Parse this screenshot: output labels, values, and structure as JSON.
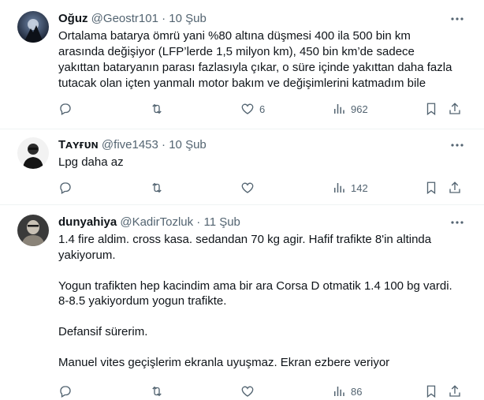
{
  "tweets": [
    {
      "name": "Oğuz",
      "handle": "@Geostr101",
      "sep": "·",
      "date": "10 Şub",
      "text": "Ortalama batarya ömrü yani %80 altına düşmesi 400 ila 500 bin km arasında değişiyor (LFP’lerde 1,5 milyon km), 450 bin km’de sadece yakıttan bataryanın parası fazlasıyla çıkar, o süre içinde yakıttan daha fazla tutacak olan içten yanmalı motor bakım ve değişimlerini katmadım bile",
      "likes": "6",
      "views": "962"
    },
    {
      "name": "Tᴀʏғᴜɴ",
      "handle": "@five1453",
      "sep": "·",
      "date": "10 Şub",
      "text": "Lpg daha az",
      "likes": "",
      "views": "142"
    },
    {
      "name": "dunyahiya",
      "handle": "@KadirTozluk",
      "sep": "·",
      "date": "11 Şub",
      "text": "1.4 fire aldim. cross kasa. sedandan 70 kg agir. Hafif trafikte 8'in altinda yakiyorum.\n\nYogun trafikten hep kacindim ama bir ara Corsa D otmatik 1.4 100 bg vardi. 8-8.5 yakiyordum yogun trafikte.\n\nDefansif sürerim.\n\nManuel vites geçişlerim ekranla uyuşmaz. Ekran ezbere veriyor",
      "likes": "",
      "views": "86"
    }
  ],
  "colors": {
    "text": "#0f1419",
    "muted": "#536471",
    "border": "#eff3f4"
  },
  "icons": [
    "reply-icon",
    "retweet-icon",
    "like-icon",
    "views-icon",
    "bookmark-icon",
    "share-icon",
    "more-icon"
  ]
}
